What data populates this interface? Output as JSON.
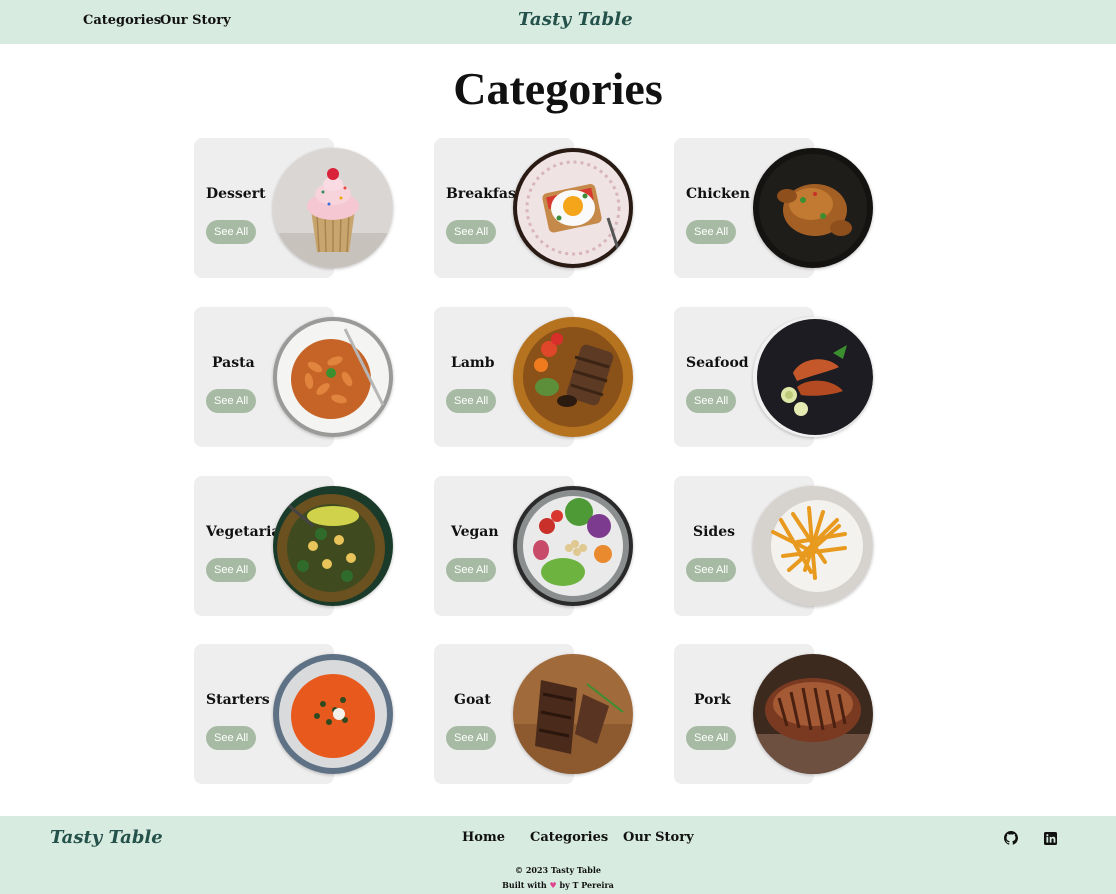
{
  "header": {
    "logo": "Tasty Table",
    "nav": [
      "Categories",
      "Our Story"
    ]
  },
  "page_title": "Categories",
  "see_all_label": "See All",
  "categories": [
    {
      "name": "Dessert",
      "photo": "cupcake"
    },
    {
      "name": "Breakfast",
      "photo": "fried-egg-toast"
    },
    {
      "name": "Chicken",
      "photo": "roast-chicken"
    },
    {
      "name": "Pasta",
      "photo": "fusilli-pasta"
    },
    {
      "name": "Lamb",
      "photo": "lamb-platter"
    },
    {
      "name": "Seafood",
      "photo": "grilled-prawns"
    },
    {
      "name": "Vegetarian",
      "photo": "vegetable-stir-fry"
    },
    {
      "name": "Vegan",
      "photo": "vegan-bowl"
    },
    {
      "name": "Sides",
      "photo": "french-fries"
    },
    {
      "name": "Starters",
      "photo": "tomato-soup"
    },
    {
      "name": "Goat",
      "photo": "goat-steak"
    },
    {
      "name": "Pork",
      "photo": "pork-roast"
    }
  ],
  "footer": {
    "logo": "Tasty Table",
    "nav": [
      "Home",
      "Categories",
      "Our Story"
    ],
    "icons": [
      "github-icon",
      "linkedin-icon"
    ],
    "copyright": "© 2023 Tasty Table",
    "built_prefix": "Built with",
    "built_heart": "♥",
    "built_suffix": "by T Pereira"
  },
  "colors": {
    "header_bg": "#d7ebe0",
    "logo": "#24524a",
    "card_bg": "#efeeee",
    "button_bg": "#a7bba4",
    "heart": "#e0468f"
  }
}
